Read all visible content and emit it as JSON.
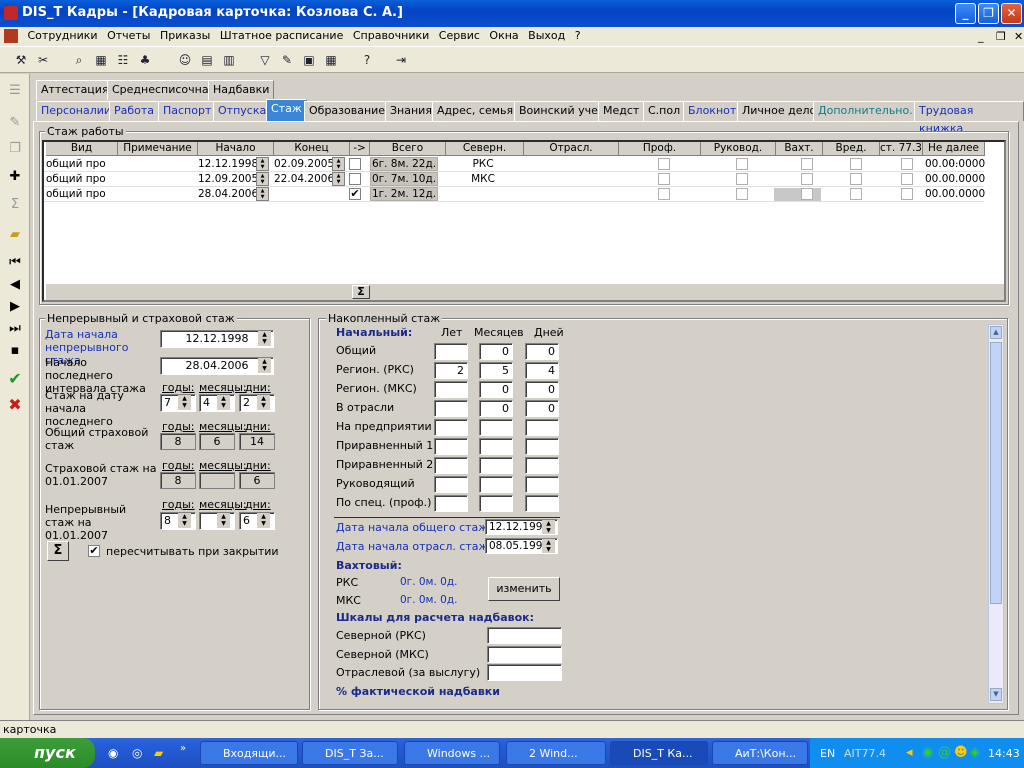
{
  "window": {
    "title": "DIS_T Кадры - [Кадровая карточка: Козлова С. А.]"
  },
  "menu": [
    "Сотрудники",
    "Отчеты",
    "Приказы",
    "Штатное расписание",
    "Справочники",
    "Сервис",
    "Окна",
    "Выход",
    "?"
  ],
  "tabs_row1": [
    "Аттестация",
    "Среднесписочная",
    "Надбавки"
  ],
  "tabs_row2": [
    "Персоналии",
    "Работа",
    "Паспорт",
    "Отпуска",
    "Стаж",
    "Образование",
    "Знания",
    "Адрес, семья",
    "Воинский учет",
    "Медст",
    "С.пол",
    "Блокнот",
    "Личное дело",
    "Дополнительно...",
    "Трудовая книжка"
  ],
  "stazh_group": {
    "title": "Стаж работы",
    "columns": [
      "Вид",
      "Примечание",
      "Начало",
      "Конец",
      "->",
      "Всего",
      "Северн.",
      "Отрасл.",
      "Проф.",
      "Руковод.",
      "Вахт.",
      "Вред.",
      "ст. 77.3",
      "Не далее ..."
    ],
    "rows": [
      {
        "vid": "общий про",
        "start": "12.12.1998",
        "end": "02.09.2005",
        "arrow": false,
        "total": "6г. 8м. 22д.",
        "north": "РКС",
        "limit": "00.00.0000"
      },
      {
        "vid": "общий про",
        "start": "12.09.2005",
        "end": "22.04.2006",
        "arrow": false,
        "total": "0г. 7м. 10д.",
        "north": "МКС",
        "limit": "00.00.0000"
      },
      {
        "vid": "общий про",
        "start": "28.04.2006",
        "end": "",
        "arrow": true,
        "total": "1г. 2м. 12д.",
        "north": "",
        "limit": "00.00.0000"
      }
    ],
    "sum_icon": "Σ"
  },
  "left_group": {
    "title": "Непрерывный и страховой стаж",
    "date_start_label": "Дата начала непрерывного стажа",
    "date_start": "12.12.1998",
    "last_start_label": "Начало последнего интервала стажа",
    "last_start": "28.04.2006",
    "stazh_on_date_label": "Стаж на дату начала последнего",
    "insurance_label": "Общий страховой стаж",
    "ins2007_label": "Страховой стаж на 01.01.2007",
    "cont2007_label": "Непрерывный стаж на 01.01.2007",
    "years": "годы:",
    "months": "месяцы:",
    "days": "дни:",
    "stazh_on_date": [
      "7",
      "4",
      "2"
    ],
    "insurance": [
      "8",
      "6",
      "14"
    ],
    "ins2007": [
      "8",
      "",
      "6"
    ],
    "cont2007": [
      "8",
      "",
      "6"
    ],
    "recalc_label": "пересчитывать при закрытии",
    "recalc_checked": true
  },
  "right_group": {
    "title": "Накопленный стаж",
    "initial": "Начальный:",
    "col_years": "Лет",
    "col_months": "Месяцев",
    "col_days": "Дней",
    "rows": [
      {
        "label": "Общий",
        "v": [
          "",
          "0",
          "0"
        ]
      },
      {
        "label": "Регион. (РКС)",
        "v": [
          "2",
          "5",
          "4"
        ]
      },
      {
        "label": "Регион. (МКС)",
        "v": [
          "",
          "0",
          "0"
        ]
      },
      {
        "label": "В отрасли",
        "v": [
          "",
          "0",
          "0"
        ]
      },
      {
        "label": "На предприятии",
        "v": [
          "",
          "",
          ""
        ]
      },
      {
        "label": "Приравненный 1",
        "v": [
          "",
          "",
          ""
        ]
      },
      {
        "label": "Приравненный 2",
        "v": [
          "",
          "",
          ""
        ]
      },
      {
        "label": "Руководящий",
        "v": [
          "",
          "",
          ""
        ]
      },
      {
        "label": "По спец. (проф.)",
        "v": [
          "",
          "",
          ""
        ]
      }
    ],
    "general_start_label": "Дата начала общего стажа",
    "general_start": "12.12.1998",
    "branch_start_label": "Дата начала отрасл. стажа",
    "branch_start": "08.05.1999",
    "vakht_label": "Вахтовый:",
    "rks": "РКС",
    "rks_val": "0г. 0м. 0д.",
    "mks": "МКС",
    "mks_val": "0г. 0м. 0д.",
    "change_btn": "изменить",
    "scales_label": "Шкалы для расчета надбавок:",
    "scale1": "Северной (РКС)",
    "scale2": "Северной (МКС)",
    "scale3": "Отраслевой (за выслугу)",
    "fact_label": "% фактической надбавки"
  },
  "status": "карточка",
  "taskbar": {
    "start": "пуск",
    "tasks": [
      "Входящи...",
      "DIS_T За...",
      "Windows ...",
      "2 Wind...",
      "DIS_T Ка...",
      "АиТ:\\Кон..."
    ],
    "lang": "EN",
    "tray_text": "AIT77.4",
    "clock": "14:43"
  }
}
